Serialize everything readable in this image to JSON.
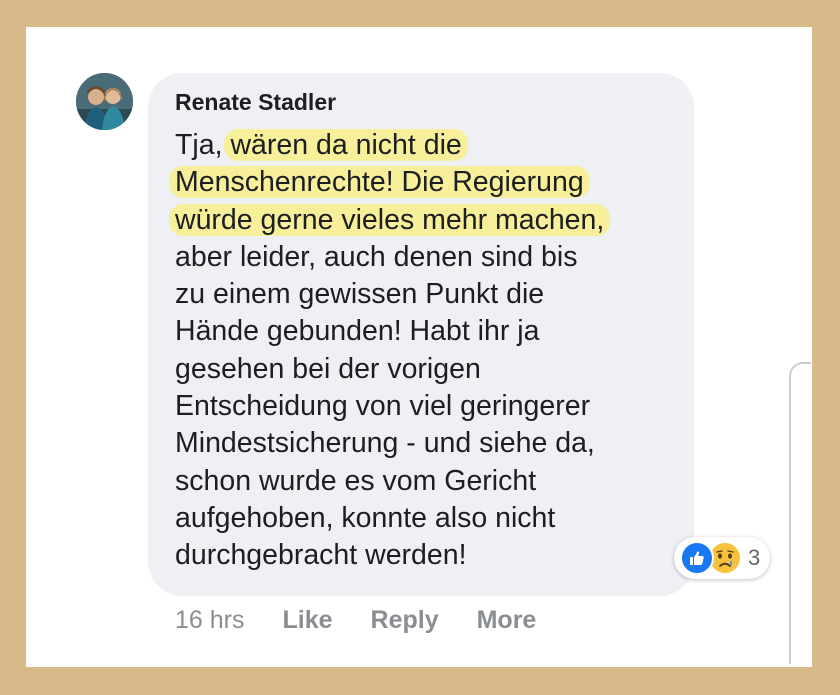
{
  "comment": {
    "author": "Renate Stadler",
    "lines": [
      {
        "pre": "Tja, ",
        "hl": "wären da nicht die"
      },
      {
        "hl": "Menschenrechte! Die Regierung"
      },
      {
        "hl": "würde gerne vieles mehr machen,"
      },
      {
        "text": "aber leider, auch denen sind bis"
      },
      {
        "text": "zu einem gewissen Punkt die"
      },
      {
        "text": "Hände gebunden! Habt ihr ja"
      },
      {
        "text": "gesehen bei der vorigen"
      },
      {
        "text": "Entscheidung von viel geringerer"
      },
      {
        "text": "Mindestsicherung - und siehe da,"
      },
      {
        "text": "schon wurde es vom Gericht"
      },
      {
        "text": "aufgehoben, konnte also nicht"
      },
      {
        "text": "durchgebracht werden!"
      }
    ],
    "reactions": {
      "icons": [
        "like-icon",
        "sad-icon"
      ],
      "count": "3"
    },
    "meta": {
      "time": "16 hrs",
      "like_label": "Like",
      "reply_label": "Reply",
      "more_label": "More"
    }
  },
  "colors": {
    "frame": "#d8b98a",
    "bubble": "#eff0f4",
    "highlight": "#ffee50",
    "like_blue": "#1877f2",
    "sad_yellow": "#f7c23e"
  }
}
